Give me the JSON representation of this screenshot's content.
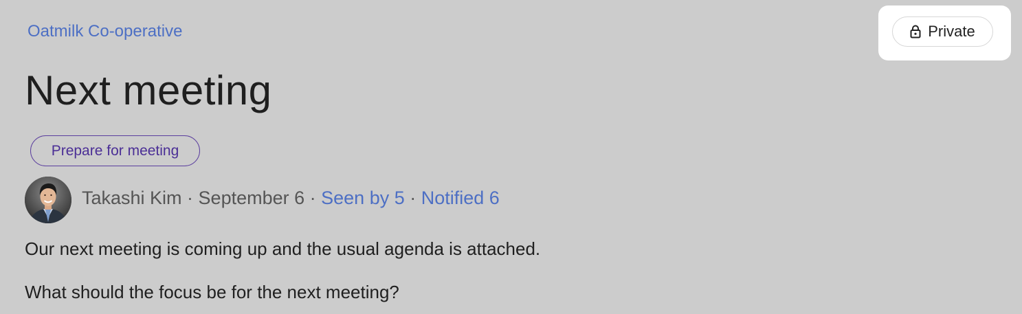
{
  "breadcrumb": {
    "label": "Oatmilk Co-operative"
  },
  "post": {
    "title": "Next meeting",
    "tag": "Prepare for meeting",
    "author": "Takashi Kim",
    "separator": " · ",
    "date": "September 6",
    "seen_by": "Seen by 5",
    "notified": "Notified 6",
    "body": [
      "Our next meeting is coming up and the usual agenda is attached.",
      "What should the focus be for the next meeting?"
    ]
  },
  "privacy": {
    "label": "Private",
    "icon": "lock-icon"
  },
  "colors": {
    "background": "#cccccc",
    "link": "#4d6fc4",
    "tag_border": "#5a3d9e",
    "tag_text": "#4b2f96",
    "text": "#1f1f1f",
    "meta_text": "#555555"
  }
}
